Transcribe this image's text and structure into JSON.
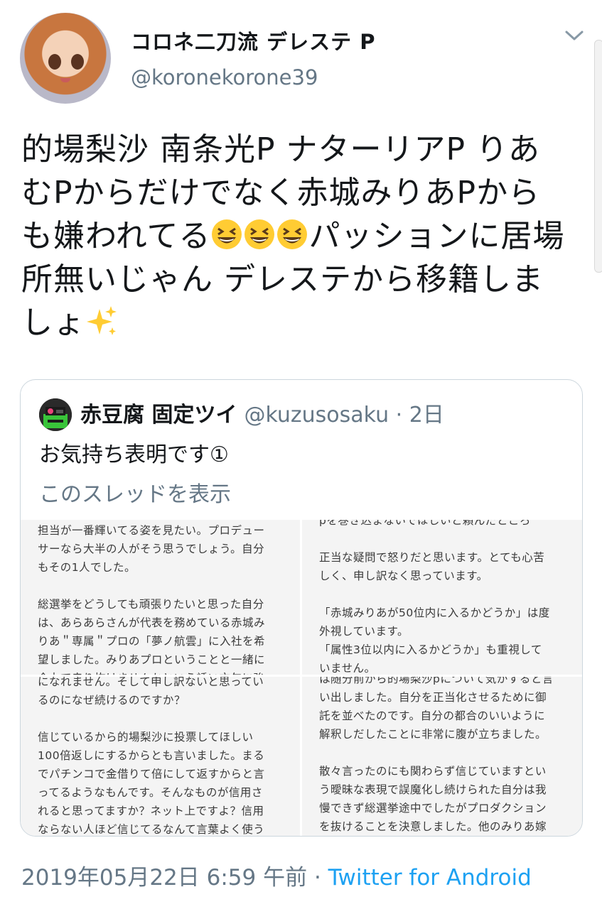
{
  "header": {
    "display_name": "コロネ二刀流 デレステ P",
    "handle": "@koronekorone39"
  },
  "tweet": {
    "text_1": "的場梨沙 南条光P ナターリアP りあむPからだけでなく赤城みりあPからも嫌われてる",
    "text_2": "パッションに居場所無いじゃん デレステから移籍しましょ",
    "emoji": [
      "grinning-squinting-face",
      "grinning-squinting-face",
      "grinning-squinting-face",
      "sparkles"
    ]
  },
  "quote": {
    "name": "赤豆腐 固定ツイ",
    "handle": "@kuzusosaku · 2日",
    "text": "お気持ち表明です①",
    "show_thread": "このスレッドを表示",
    "images": [
      "担当が一番輝いてる姿を見たい。プロデュー\nサーなら大半の人がそう思うでしょう。自分\nもその1人でした。\n\n総選挙をどうしても頑張りたいと思った自分\nは、あらあらさんが代表を務めている赤城み\nりあ＂専属＂プロの「夢ノ航雲」に入社を希\n望しました。みりあプロということと一緒に\n全力で走り抜けませんかという誘い文句に強",
      "pを巻き込まないでほしいと頼んだところ\n\n正当な疑問で怒りだと思います。とても心苦\nしく、申し訳なく思っています。\n\n「赤城みりあが50位内に入るかどうか」は度\n外視しています。\n「属性3位以内に入るかどうか」も重視して\nいません。",
      "になれません。そして申し訳ないと思ってい\nるのになぜ続けるのですか？\n\n信じているから的場梨沙に投票してほしい\n100倍返しにするからとも言いました。まる\nでパチンコで金借りて倍にして返すからと言\nってるようなもんです。そんなものが信用さ\nれると思ってますか？ネット上ですよ？信用\nならない人ほど信じてるなんて言葉よく使う",
      "は随分前から的場梨沙pについて気がすると言\nい出しました。自分を正当化させるために御\n託を並べたのです。自分の都合のいいように\n解釈しだしたことに非常に腹が立ちました。\n\n散々言ったのにも関わらず信じていますとい\nう曖昧な表現で誤魔化し続けられた自分は我\n慢できず総選挙途中でしたがプロダクション\nを抜けることを決意しました。他のみりあ嫁"
    ]
  },
  "meta": {
    "timestamp": "2019年05月22日 6:59 午前",
    "separator": " · ",
    "source": "Twitter for Android"
  }
}
